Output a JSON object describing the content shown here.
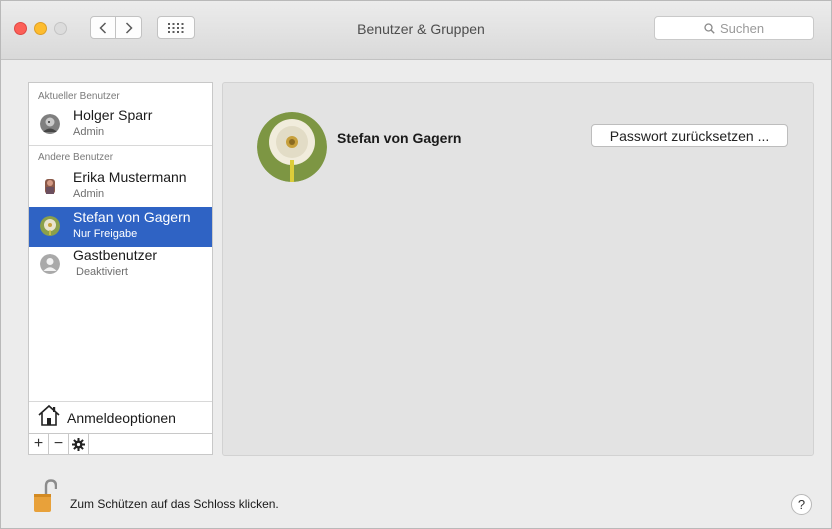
{
  "window": {
    "title": "Benutzer & Gruppen"
  },
  "search": {
    "placeholder": "Suchen"
  },
  "sidebar": {
    "current_section": "Aktueller Benutzer",
    "other_section": "Andere Benutzer",
    "users": [
      {
        "name": "Holger Sparr",
        "role": "Admin"
      },
      {
        "name": "Erika Mustermann",
        "role": "Admin"
      },
      {
        "name": "Stefan von Gagern",
        "role": "Nur Freigabe",
        "selected": true
      },
      {
        "name": "Gastbenutzer",
        "role": "Deaktiviert"
      }
    ],
    "login_options": "Anmeldeoptionen",
    "toolbar": {
      "add": "+",
      "remove": "−"
    }
  },
  "detail": {
    "name": "Stefan von Gagern",
    "reset_password_label": "Passwort zurücksetzen ..."
  },
  "footer": {
    "lock_text": "Zum Schützen auf das Schloss klicken.",
    "help_label": "?"
  },
  "colors": {
    "selection": "#2f63c4",
    "close": "#fc5f57",
    "minimize": "#fdbc2e",
    "lock": "#e8a13a"
  },
  "icons": [
    "chevron-left-icon",
    "chevron-right-icon",
    "grid-icon",
    "search-icon",
    "house-icon",
    "gear-icon",
    "lock-icon",
    "help-icon"
  ]
}
